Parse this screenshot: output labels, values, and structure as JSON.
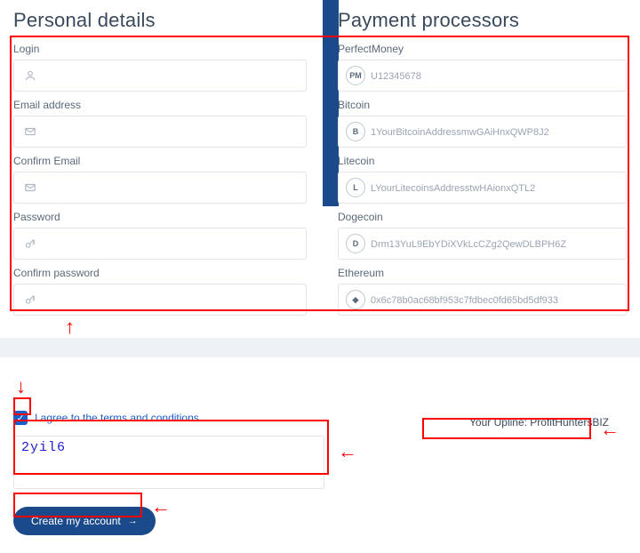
{
  "personal": {
    "heading": "Personal details",
    "login_label": "Login",
    "email_label": "Email address",
    "confirm_email_label": "Confirm Email",
    "password_label": "Password",
    "confirm_password_label": "Confirm password"
  },
  "payment": {
    "heading": "Payment processors",
    "processors": [
      {
        "label": "PerfectMoney",
        "icon": "PM",
        "placeholder": "U12345678"
      },
      {
        "label": "Bitcoin",
        "icon": "B",
        "placeholder": "1YourBitcoinAddressmwGAiHnxQWP8J2"
      },
      {
        "label": "Litecoin",
        "icon": "L",
        "placeholder": "LYourLitecoinsAddresstwHAionxQTL2"
      },
      {
        "label": "Dogecoin",
        "icon": "D",
        "placeholder": "Drm13YuL9EbYDiXVkLcCZg2QewDLBPH6Z"
      },
      {
        "label": "Ethereum",
        "icon": "◆",
        "placeholder": "0x6c78b0ac68bf953c7fdbec0fd65bd5df933"
      }
    ]
  },
  "terms": {
    "label": "I agree to the terms and conditions"
  },
  "captcha": {
    "text": "2yil6"
  },
  "upline": {
    "text": "Your Upline: ProfitHuntersBIZ"
  },
  "button": {
    "label": "Create my account"
  }
}
